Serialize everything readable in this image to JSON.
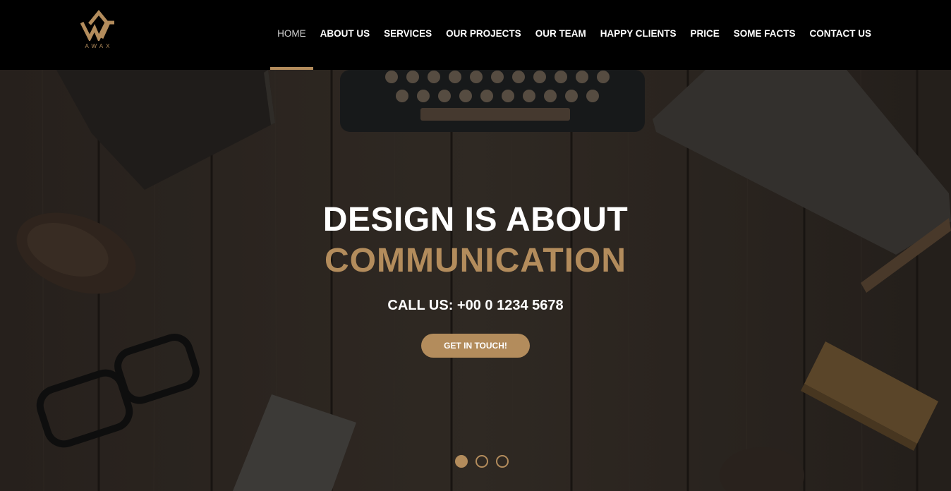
{
  "brand": {
    "name": "AWAX",
    "logo_icon": "awax-w-logo",
    "accent": "#b38c5c"
  },
  "nav": {
    "items": [
      {
        "label": "HOME",
        "active": true
      },
      {
        "label": "ABOUT US"
      },
      {
        "label": "SERVICES"
      },
      {
        "label": "OUR PROJECTS"
      },
      {
        "label": "OUR TEAM"
      },
      {
        "label": "HAPPY CLIENTS"
      },
      {
        "label": "PRICE"
      },
      {
        "label": "SOME FACTS"
      },
      {
        "label": "CONTACT US"
      }
    ]
  },
  "hero": {
    "headline_line1": "DESIGN IS ABOUT",
    "headline_line2": "COMMUNICATION",
    "call_us": "CALL US: +00 0 1234 5678",
    "cta_label": "GET IN TOUCH!",
    "slides": 3,
    "active_slide": 1
  }
}
